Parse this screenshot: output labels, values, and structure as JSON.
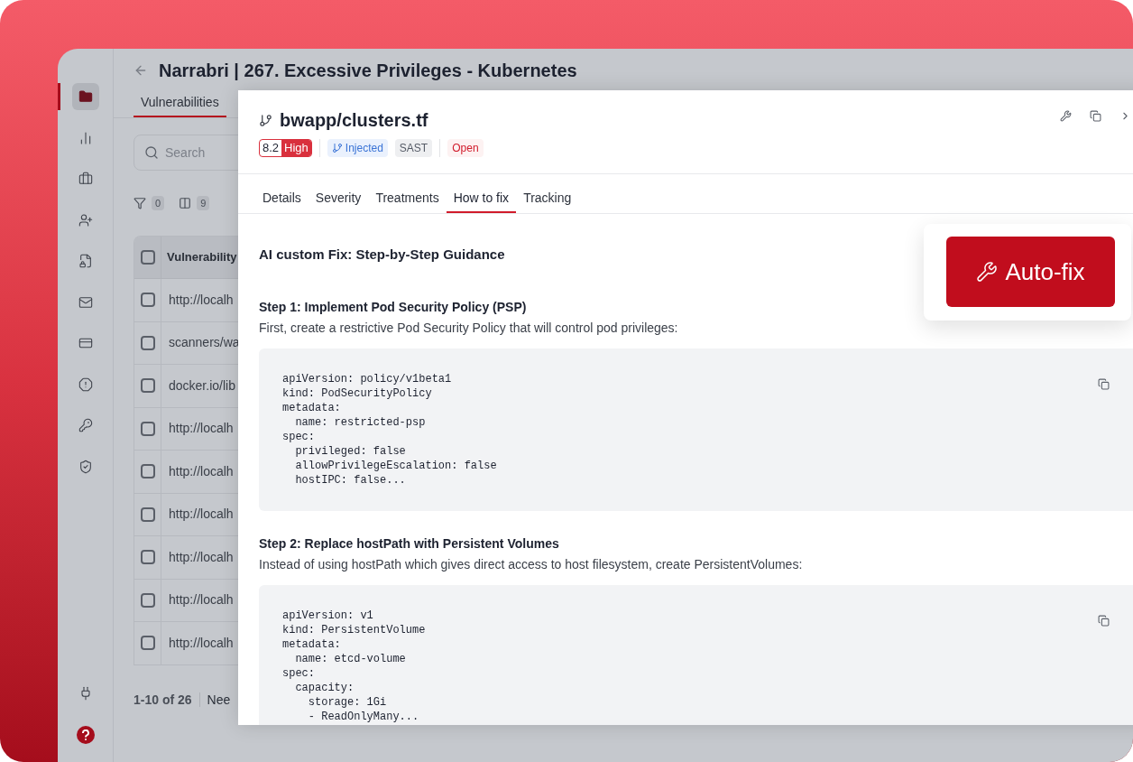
{
  "sidebar": {
    "items": [
      {
        "kind": "folder",
        "selected": true
      },
      {
        "kind": "chart",
        "selected": false
      },
      {
        "kind": "briefcase",
        "selected": false
      },
      {
        "kind": "user-plus",
        "selected": false
      },
      {
        "kind": "file-shield",
        "selected": false
      },
      {
        "kind": "mail",
        "selected": false
      },
      {
        "kind": "card",
        "selected": false
      },
      {
        "kind": "alert",
        "selected": false
      },
      {
        "kind": "key",
        "selected": false
      },
      {
        "kind": "shield",
        "selected": false
      }
    ],
    "bottom_items": [
      {
        "kind": "plug"
      },
      {
        "kind": "help"
      }
    ]
  },
  "page": {
    "title": "Narrabri | 267. Excessive Privileges - Kubernetes",
    "tabs": [
      {
        "label": "Vulnerabilities",
        "selected": true
      }
    ],
    "search": {
      "placeholder": "Search"
    },
    "toolbar": [
      {
        "kind": "filter",
        "count": "0"
      },
      {
        "kind": "columns",
        "count": "9"
      }
    ],
    "table": {
      "header_checked": false,
      "columns": [
        "Vulnerability"
      ],
      "rows": [
        {
          "checked": false,
          "cells": [
            "http://localh"
          ]
        },
        {
          "checked": false,
          "cells": [
            "scanners/wa"
          ]
        },
        {
          "checked": false,
          "cells": [
            "docker.io/lib"
          ]
        },
        {
          "checked": false,
          "cells": [
            "http://localh"
          ]
        },
        {
          "checked": false,
          "cells": [
            "http://localh"
          ]
        },
        {
          "checked": false,
          "cells": [
            "http://localh"
          ]
        },
        {
          "checked": false,
          "cells": [
            "http://localh"
          ]
        },
        {
          "checked": false,
          "cells": [
            "http://localh"
          ]
        },
        {
          "checked": false,
          "cells": [
            "http://localh"
          ]
        }
      ]
    },
    "footer": {
      "range": "1-10 of 26",
      "column_2": "Nee"
    }
  },
  "drawer": {
    "title": "bwapp/clusters.tf",
    "score": "8.2",
    "severity": "High",
    "badges": [
      {
        "kind": "injected",
        "label": "Injected"
      },
      {
        "kind": "technique",
        "label": "SAST"
      },
      {
        "kind": "status",
        "label": "Open"
      }
    ],
    "tabs": [
      {
        "label": "Details",
        "selected": false
      },
      {
        "label": "Severity",
        "selected": false
      },
      {
        "label": "Treatments",
        "selected": false
      },
      {
        "label": "How to fix",
        "selected": true
      },
      {
        "label": "Tracking",
        "selected": false
      }
    ],
    "guide": {
      "heading": "AI custom Fix: Step-by-Step Guidance",
      "steps": [
        {
          "title": "Step 1: Implement Pod Security Policy (PSP)",
          "description": "First, create a restrictive Pod Security Policy that will control pod privileges:",
          "code": "apiVersion: policy/v1beta1\nkind: PodSecurityPolicy\nmetadata:\n  name: restricted-psp\nspec:\n  privileged: false\n  allowPrivilegeEscalation: false\n  hostIPC: false..."
        },
        {
          "title": "Step 2: Replace hostPath with Persistent Volumes",
          "description": "Instead of using hostPath which gives direct access to host filesystem, create PersistentVolumes:",
          "code": "apiVersion: v1\nkind: PersistentVolume\nmetadata:\n  name: etcd-volume\nspec:\n  capacity:\n    storage: 1Gi\n    - ReadOnlyMany..."
        }
      ]
    },
    "auto_fix": {
      "label": "Auto-fix"
    }
  }
}
